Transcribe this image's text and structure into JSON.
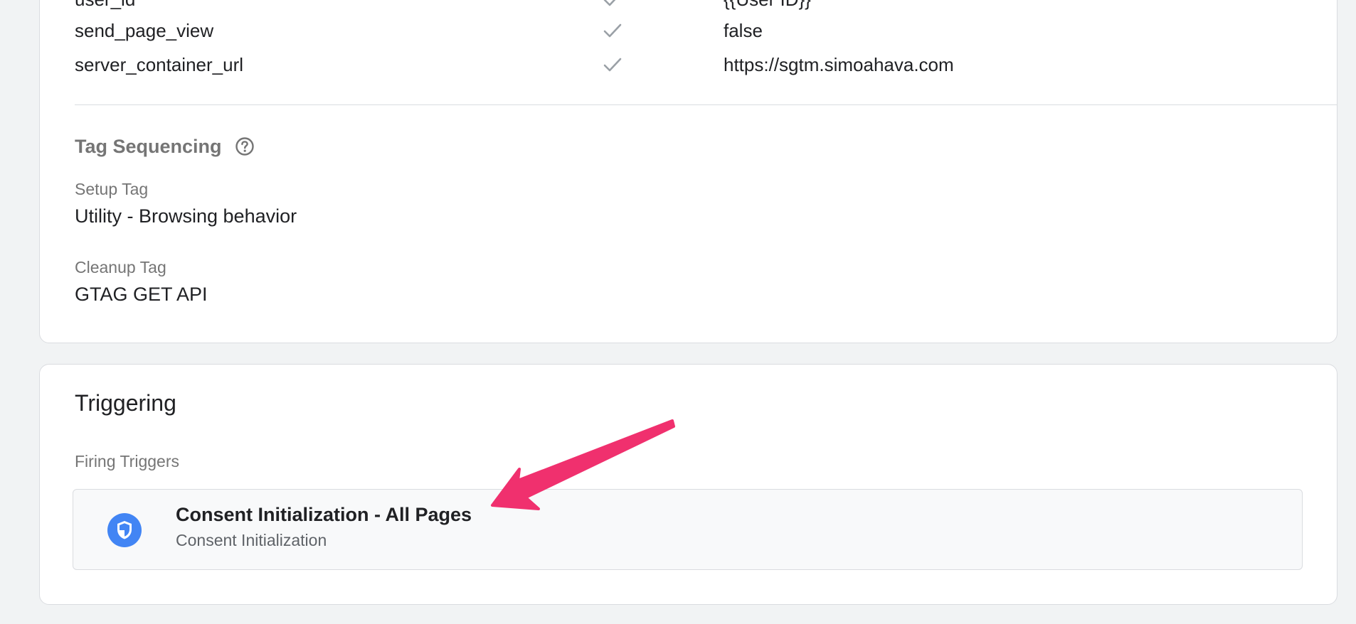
{
  "fields": {
    "rows": [
      {
        "name": "user_id",
        "checked": true,
        "value": "{{User ID}}"
      },
      {
        "name": "send_page_view",
        "checked": true,
        "value": "false"
      },
      {
        "name": "server_container_url",
        "checked": true,
        "value": "https://sgtm.simoahava.com"
      }
    ]
  },
  "tag_sequencing": {
    "title": "Tag Sequencing",
    "help_icon": "help-circle-icon",
    "setup_tag_label": "Setup Tag",
    "setup_tag_value": "Utility - Browsing behavior",
    "cleanup_tag_label": "Cleanup Tag",
    "cleanup_tag_value": "GTAG GET API"
  },
  "triggering": {
    "title": "Triggering",
    "firing_triggers_label": "Firing Triggers",
    "trigger": {
      "name": "Consent Initialization - All Pages",
      "type": "Consent Initialization",
      "icon": "shield-icon",
      "icon_color": "#4285f4"
    }
  },
  "annotation": {
    "arrow_color": "#f0306e"
  }
}
